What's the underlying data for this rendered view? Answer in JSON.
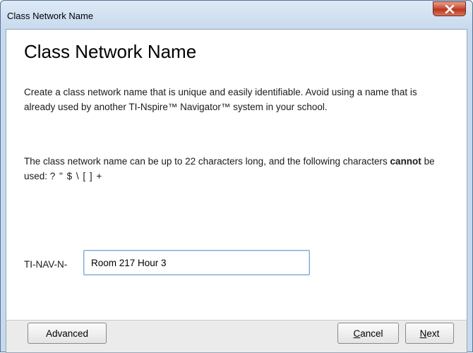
{
  "window": {
    "title": "Class Network Name"
  },
  "main": {
    "heading": "Class Network Name",
    "paragraph1": "Create a class network name that is unique and easily identifiable. Avoid using a name that is already used by another TI-Nspire™ Navigator™ system in your school.",
    "paragraph2_prefix": "The class network name can be up to 22 characters long, and the following characters ",
    "paragraph2_bold": "cannot",
    "paragraph2_suffix": " be used: ",
    "forbidden_chars": "? \" $ \\ [ ] +",
    "field_label": "TI-NAV-N-",
    "field_value": "Room 217 Hour 3"
  },
  "buttons": {
    "advanced": "Advanced",
    "cancel_mnemonic": "C",
    "cancel_rest": "ancel",
    "next_mnemonic": "N",
    "next_rest": "ext"
  },
  "icons": {
    "close": "close-icon"
  },
  "colors": {
    "titlebar": "#c8daee",
    "close_button": "#c8462e",
    "input_border": "#7aa7d6"
  }
}
